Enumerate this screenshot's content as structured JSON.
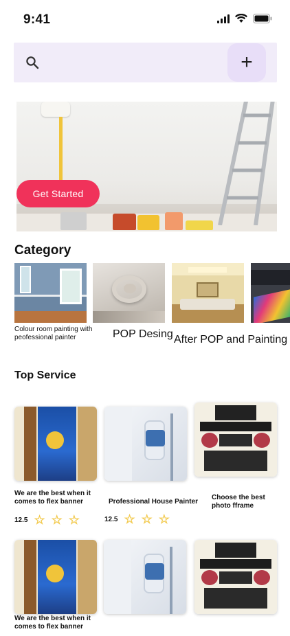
{
  "status_bar": {
    "time": "9:41"
  },
  "search": {
    "placeholder": "",
    "value": "",
    "add_label": "+"
  },
  "hero": {
    "cta_label": "Get Started"
  },
  "category": {
    "heading": "Category",
    "items": [
      {
        "caption": "Colour room painting with peofessional painter"
      },
      {
        "caption": "POP Desing"
      },
      {
        "caption": "After POP and Painting"
      },
      {
        "caption": ""
      }
    ]
  },
  "top_service": {
    "heading": "Top Service",
    "rows": [
      [
        {
          "title": "We are the best when it comes to flex banner",
          "rating": "12.5",
          "stars": 3
        },
        {
          "title": "Professional House Painter",
          "rating": "12.5",
          "stars": 3
        },
        {
          "title": "Choose the best photo fframe",
          "rating": "",
          "stars": 0
        }
      ],
      [
        {
          "title": "We are the best when it comes to flex banner"
        },
        {
          "title": ""
        },
        {
          "title": ""
        }
      ]
    ]
  },
  "colors": {
    "accent": "#f0325a",
    "search_bg": "#f1ecf9",
    "add_bg": "#e8def8",
    "star": "#f2c94c"
  }
}
